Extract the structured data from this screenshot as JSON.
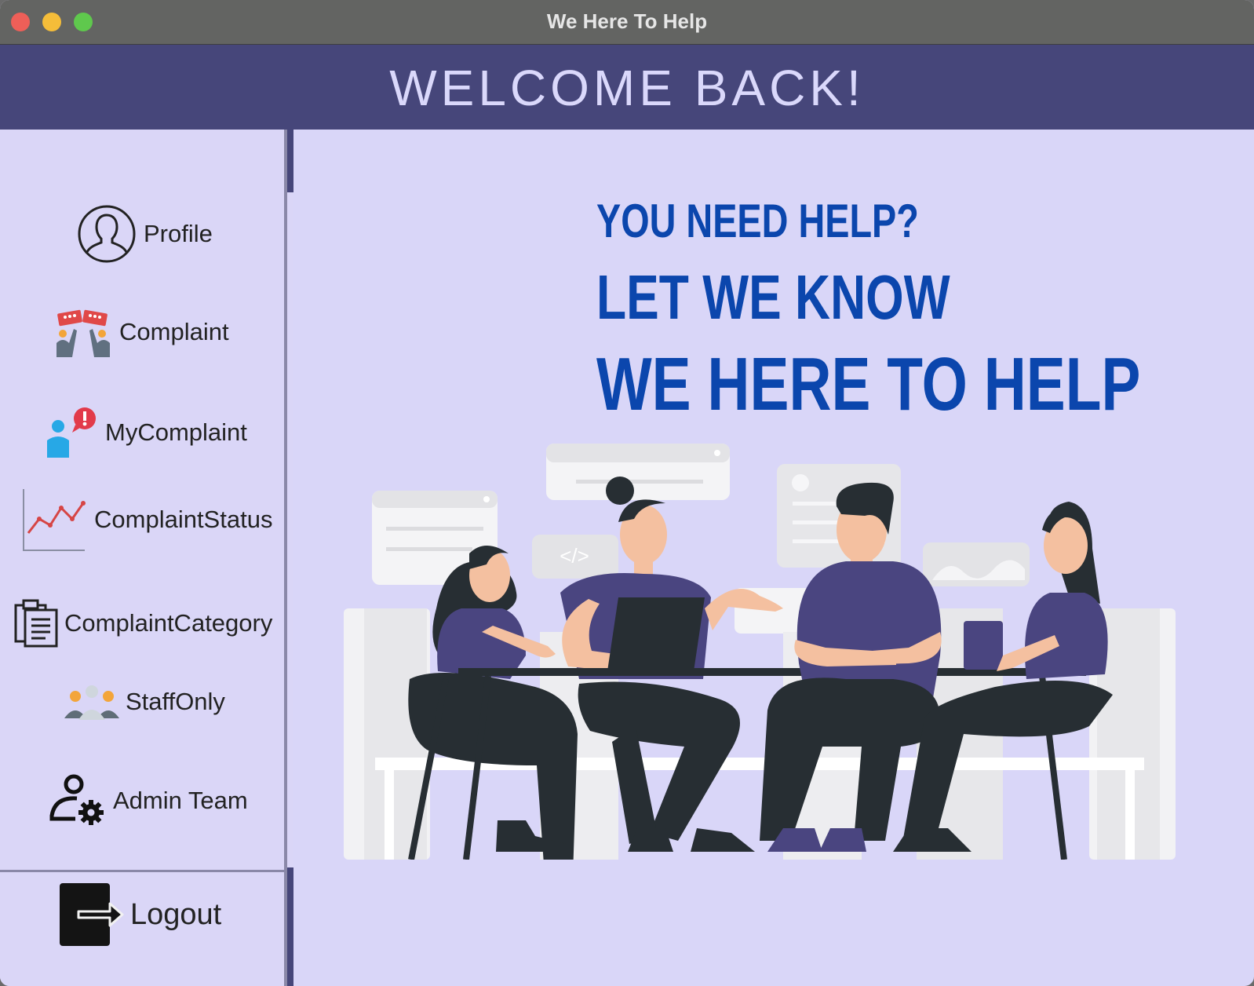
{
  "window": {
    "title": "We Here To Help"
  },
  "header": {
    "title": "WELCOME BACK!"
  },
  "sidebar": {
    "items": [
      {
        "label": "Profile",
        "icon": "user-circle-icon"
      },
      {
        "label": "Complaint",
        "icon": "protest-signs-icon"
      },
      {
        "label": "MyComplaint",
        "icon": "user-alert-icon"
      },
      {
        "label": "ComplaintStatus",
        "icon": "line-chart-icon"
      },
      {
        "label": "ComplaintCategory",
        "icon": "clipboard-list-icon"
      },
      {
        "label": "StaffOnly",
        "icon": "staff-group-icon"
      },
      {
        "label": "Admin Team",
        "icon": "user-settings-icon"
      }
    ],
    "logout": {
      "label": "Logout",
      "icon": "logout-arrow-icon"
    }
  },
  "main": {
    "slogan": [
      "YOU NEED HELP?",
      "LET WE KNOW",
      "WE HERE TO HELP"
    ],
    "illustration": "team-meeting-illustration"
  },
  "colors": {
    "header_bg": "#46467a",
    "content_bg": "#d9d6f8",
    "slogan": "#0b46ad",
    "shirt": "#4a4580",
    "pants": "#272e33"
  }
}
